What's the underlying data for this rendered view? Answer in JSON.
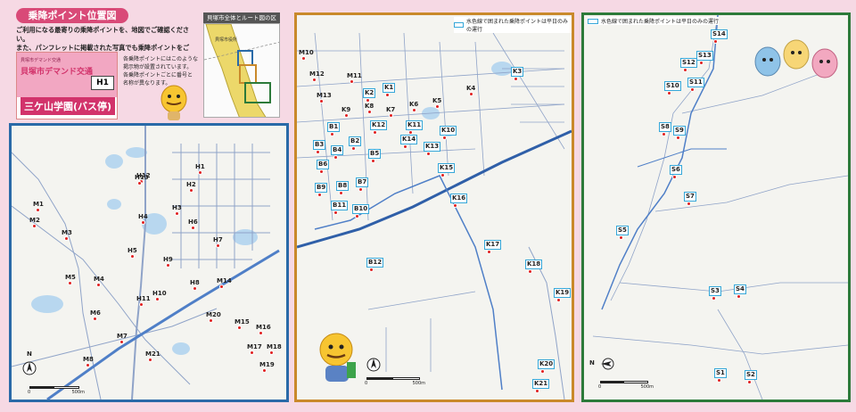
{
  "intro": {
    "heading": "乗降ポイント位置図",
    "line1": "ご利用になる最寄りの乗降ポイントを、地図でご確認ください。",
    "line2": "また、パンフレットに掲載された写真でも乗降ポイントをご紹介",
    "line3": "しています。",
    "sign_title": "貝塚市デマンド交通",
    "sign_logo": "貝塚市デマンド交通",
    "sign_code": "H1",
    "sign_stop": "三ケ山学園(バス停)",
    "sign_note1": "各乗降ポイントにはこのような",
    "sign_note2": "掲示物が設置されています。",
    "sign_note3": "各乗降ポイントごとに番号と",
    "sign_note4": "名称が異なります。"
  },
  "region_map": {
    "title": "貝塚市全体とルート図の区分け",
    "label": "貝塚市役所"
  },
  "legend": {
    "text": "水色線で囲まれた乗降ポイントは平日のみの運行"
  },
  "scale": {
    "zero": "0",
    "max": "500m"
  },
  "compass_label": "N",
  "stops_h": [
    {
      "id": "M1",
      "boxed": false
    },
    {
      "id": "M2",
      "boxed": false
    },
    {
      "id": "M3",
      "boxed": false
    },
    {
      "id": "M4",
      "boxed": false
    },
    {
      "id": "M5",
      "boxed": false
    },
    {
      "id": "M6",
      "boxed": false
    },
    {
      "id": "M7",
      "boxed": false
    },
    {
      "id": "M8",
      "boxed": false
    },
    {
      "id": "H1",
      "boxed": false
    },
    {
      "id": "H2",
      "boxed": false
    },
    {
      "id": "H3",
      "boxed": false
    },
    {
      "id": "H4",
      "boxed": false
    },
    {
      "id": "H5",
      "boxed": false
    },
    {
      "id": "H6",
      "boxed": false
    },
    {
      "id": "H7",
      "boxed": false
    },
    {
      "id": "H8",
      "boxed": false
    },
    {
      "id": "H9",
      "boxed": false
    },
    {
      "id": "H10",
      "boxed": false
    },
    {
      "id": "H11",
      "boxed": false
    },
    {
      "id": "H12",
      "boxed": false
    },
    {
      "id": "H13",
      "boxed": false
    },
    {
      "id": "M14",
      "boxed": false
    },
    {
      "id": "M15",
      "boxed": false
    },
    {
      "id": "M16",
      "boxed": false
    },
    {
      "id": "M17",
      "boxed": false
    },
    {
      "id": "M18",
      "boxed": false
    },
    {
      "id": "M19",
      "boxed": false
    },
    {
      "id": "M20",
      "boxed": false
    },
    {
      "id": "M21",
      "boxed": false
    }
  ],
  "stops_k": [
    {
      "id": "M10",
      "boxed": false
    },
    {
      "id": "M11",
      "boxed": false
    },
    {
      "id": "M12",
      "boxed": false
    },
    {
      "id": "M13",
      "boxed": false
    },
    {
      "id": "K1",
      "boxed": true
    },
    {
      "id": "K2",
      "boxed": true
    },
    {
      "id": "K3",
      "boxed": true
    },
    {
      "id": "K4",
      "boxed": false
    },
    {
      "id": "K5",
      "boxed": false
    },
    {
      "id": "K6",
      "boxed": false
    },
    {
      "id": "K7",
      "boxed": false
    },
    {
      "id": "K8",
      "boxed": false
    },
    {
      "id": "K9",
      "boxed": false
    },
    {
      "id": "K10",
      "boxed": true
    },
    {
      "id": "K11",
      "boxed": true
    },
    {
      "id": "K12",
      "boxed": true
    },
    {
      "id": "K13",
      "boxed": true
    },
    {
      "id": "K14",
      "boxed": true
    },
    {
      "id": "K15",
      "boxed": true
    },
    {
      "id": "K16",
      "boxed": true
    },
    {
      "id": "K17",
      "boxed": true
    },
    {
      "id": "K18",
      "boxed": true
    },
    {
      "id": "K19",
      "boxed": true
    },
    {
      "id": "K20",
      "boxed": true
    },
    {
      "id": "K21",
      "boxed": true
    },
    {
      "id": "B1",
      "boxed": true
    },
    {
      "id": "B2",
      "boxed": true
    },
    {
      "id": "B3",
      "boxed": true
    },
    {
      "id": "B4",
      "boxed": true
    },
    {
      "id": "B5",
      "boxed": true
    },
    {
      "id": "B6",
      "boxed": true
    },
    {
      "id": "B7",
      "boxed": true
    },
    {
      "id": "B8",
      "boxed": true
    },
    {
      "id": "B9",
      "boxed": true
    },
    {
      "id": "B10",
      "boxed": true
    },
    {
      "id": "B11",
      "boxed": true
    },
    {
      "id": "B12",
      "boxed": true
    }
  ],
  "stops_s": [
    {
      "id": "S14",
      "boxed": true
    },
    {
      "id": "S13",
      "boxed": true
    },
    {
      "id": "S12",
      "boxed": true
    },
    {
      "id": "S11",
      "boxed": true
    },
    {
      "id": "S10",
      "boxed": true
    },
    {
      "id": "S9",
      "boxed": true
    },
    {
      "id": "S8",
      "boxed": true
    },
    {
      "id": "S7",
      "boxed": true
    },
    {
      "id": "S6",
      "boxed": true
    },
    {
      "id": "S5",
      "boxed": true
    },
    {
      "id": "S4",
      "boxed": true
    },
    {
      "id": "S3",
      "boxed": true
    },
    {
      "id": "S2",
      "boxed": true
    },
    {
      "id": "S1",
      "boxed": true
    }
  ],
  "colors": {
    "page_bg": "#f6d9e4",
    "accent_pink": "#d94a78",
    "panel1_border": "#2a6aa8",
    "panel2_border": "#c9892b",
    "panel3_border": "#2c7a3a",
    "stop_dot": "#e02020",
    "weekday_box": "#35a7d9",
    "road": "#8fa3c8",
    "water": "#b8d7ef"
  }
}
